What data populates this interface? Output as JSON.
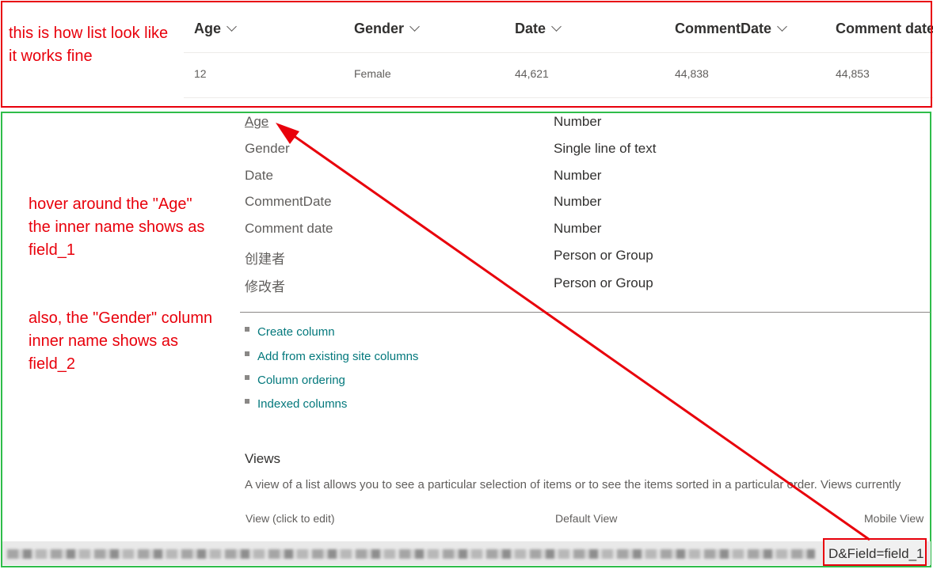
{
  "list": {
    "columns": [
      "Age",
      "Gender",
      "Date",
      "CommentDate",
      "Comment date"
    ],
    "row": [
      "12",
      "Female",
      "44,621",
      "44,838",
      "44,853"
    ]
  },
  "annotations": {
    "list_note": "this is how list look like\nit works fine",
    "hover_note": "hover around the \"Age\"\nthe inner name shows as\nfield_1",
    "gender_note": "also, the \"Gender\" column\ninner name shows as\nfield_2"
  },
  "columns_settings": {
    "fields": [
      {
        "name": "Age",
        "type": "Number"
      },
      {
        "name": "Gender",
        "type": "Single line of text"
      },
      {
        "name": "Date",
        "type": "Number"
      },
      {
        "name": "CommentDate",
        "type": "Number"
      },
      {
        "name": "Comment date",
        "type": "Number"
      },
      {
        "name": "创建者",
        "type": "Person or Group"
      },
      {
        "name": "修改者",
        "type": "Person or Group"
      }
    ],
    "links": [
      "Create column",
      "Add from existing site columns",
      "Column ordering",
      "Indexed columns"
    ]
  },
  "views": {
    "title": "Views",
    "description": "A view of a list allows you to see a particular selection of items or to see the items sorted in a particular order. Views currently",
    "col_view": "View (click to edit)",
    "col_default": "Default View",
    "col_mobile": "Mobile View"
  },
  "status_bar": {
    "url_fragment": "D&Field=field_1"
  },
  "colors": {
    "annotation_red": "#e8000b",
    "section_green": "#2fbd4a",
    "link_teal": "#03787c"
  }
}
